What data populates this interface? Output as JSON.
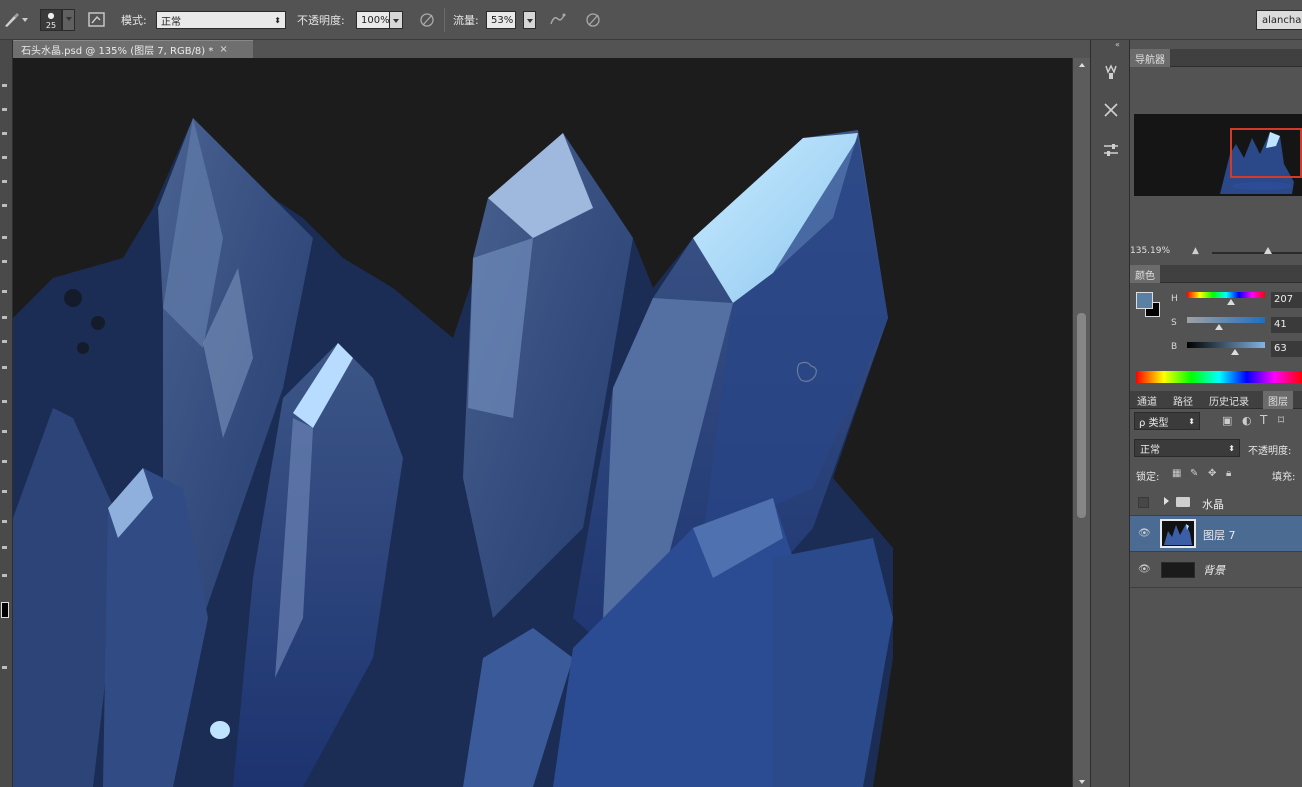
{
  "options_bar": {
    "brush_size": "25",
    "mode_label": "模式:",
    "mode_value": "正常",
    "opacity_label": "不透明度:",
    "opacity_value": "100%",
    "flow_label": "流量:",
    "flow_value": "53%",
    "user_label": "alanchar"
  },
  "document_tab": {
    "title": "石头水晶.psd @ 135% (图层 7, RGB/8) *",
    "close": "×"
  },
  "navigator": {
    "tab_label": "导航器",
    "zoom": "135.19%"
  },
  "color_panel": {
    "tab_label": "颜色",
    "h_label": "H",
    "h_value": "207",
    "s_label": "S",
    "s_value": "41",
    "b_label": "B",
    "b_value": "63",
    "foreground_color": "#5a80a4",
    "background_color": "#000000"
  },
  "layers_panel": {
    "tabs": [
      "通道",
      "路径",
      "历史记录",
      "图层"
    ],
    "filter_label": "ρ 类型",
    "blend_mode": "正常",
    "opacity_label": "不透明度:",
    "lock_label": "锁定:",
    "fill_label": "填充:",
    "layers": [
      {
        "name": "水晶",
        "kind": "group",
        "visible": false,
        "selected": false
      },
      {
        "name": "图层 7",
        "kind": "layer",
        "visible": true,
        "selected": true
      },
      {
        "name": "背景",
        "kind": "background",
        "visible": true,
        "selected": false
      }
    ]
  },
  "colors": {
    "ui_dark": "#535353",
    "canvas_bg": "#1c1c1c",
    "selected_layer": "#4c6b93",
    "nav_frame": "#d43a2a"
  }
}
